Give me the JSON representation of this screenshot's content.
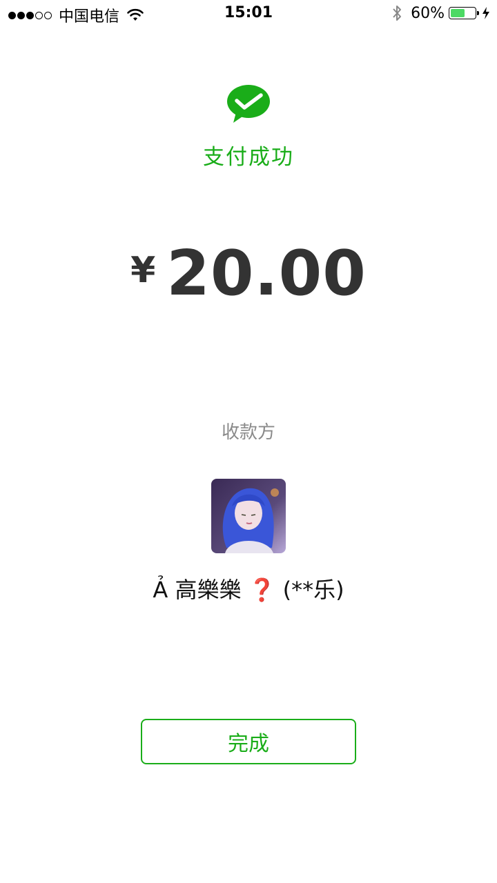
{
  "status_bar": {
    "carrier": "中国电信",
    "time": "15:01",
    "battery_percent": "60%",
    "battery_level": 0.6,
    "signal_bars_filled": 3,
    "signal_bars_total": 5
  },
  "result": {
    "title": "支付成功",
    "currency_symbol": "¥",
    "amount": "20.00",
    "accent_color": "#1aad19"
  },
  "payee": {
    "label": "收款方",
    "name": "Ả 高樂樂 ❓ (**乐)"
  },
  "actions": {
    "done_label": "完成"
  }
}
